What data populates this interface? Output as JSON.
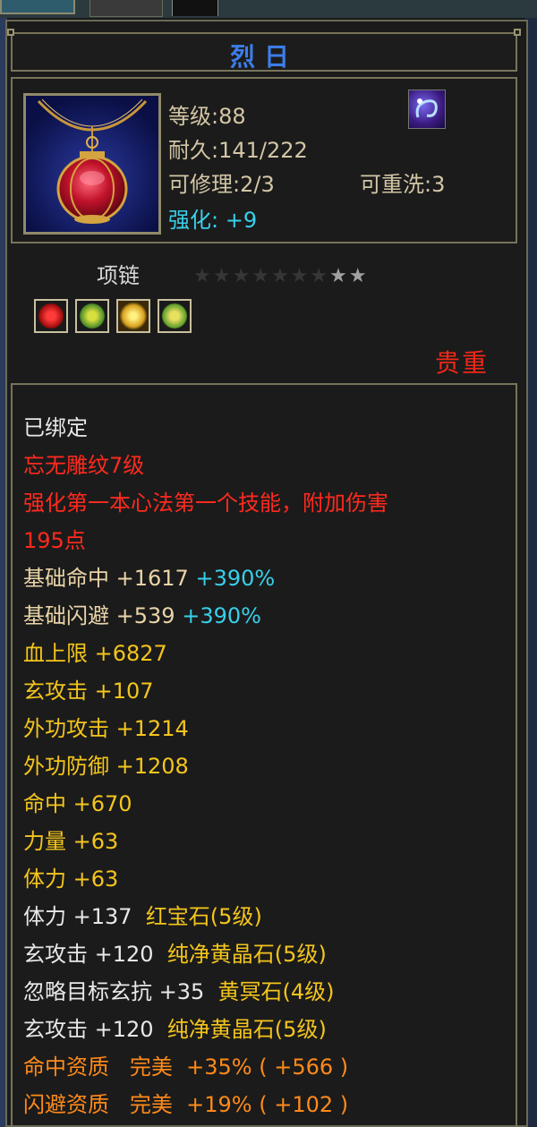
{
  "window": {
    "tab_label": "",
    "tab2_label": ""
  },
  "item": {
    "name": "烈日",
    "level_text": "等级:88",
    "durability_text": "耐久:141/222",
    "repair_text": "可修理:2/3",
    "rewash_text": "可重洗:3",
    "enhance_label": "强化:",
    "enhance_value": "+9",
    "type": "项链",
    "stars_filled": 7,
    "stars_total": 9,
    "rarity": "贵重",
    "gem_slots": [
      "red-gem-icon",
      "green-gem-icon",
      "yellow-gem-icon",
      "green-gem-icon"
    ]
  },
  "attributes": {
    "bound": "已绑定",
    "engraving": "忘无雕纹7级",
    "engraving_effect_1": "强化第一本心法第一个技能，附加伤害",
    "engraving_effect_2": "195点",
    "base_hit": {
      "label": "基础命中",
      "value": "+1617",
      "bonus": "+390%"
    },
    "base_dodge": {
      "label": "基础闪避",
      "value": "+539",
      "bonus": "+390%"
    },
    "stats": [
      "血上限 +6827",
      "玄攻击 +107",
      "外功攻击 +1214",
      "外功防御 +1208",
      "命中 +670",
      "力量 +63",
      "体力 +63"
    ],
    "gems": [
      {
        "stat": "体力 +137",
        "gem": "红宝石(5级)"
      },
      {
        "stat": "玄攻击 +120",
        "gem": "纯净黄晶石(5级)"
      },
      {
        "stat": "忽略目标玄抗 +35",
        "gem": "黄冥石(4级)"
      },
      {
        "stat": "玄攻击 +120",
        "gem": "纯净黄晶石(5级)"
      }
    ],
    "aptitudes": [
      {
        "label": "命中资质",
        "grade": "完美",
        "pct": "+35%",
        "val": "( +566 )"
      },
      {
        "label": "闪避资质",
        "grade": "完美",
        "pct": "+19%",
        "val": "( +102 )"
      }
    ]
  },
  "colors": {
    "title": "#3c7de8",
    "enhance": "#38d0ea",
    "rarity": "#f02818",
    "engraving": "#ff2a1e",
    "stat_yellow": "#f4c51c",
    "aptitude_orange": "#ff8a1a"
  }
}
